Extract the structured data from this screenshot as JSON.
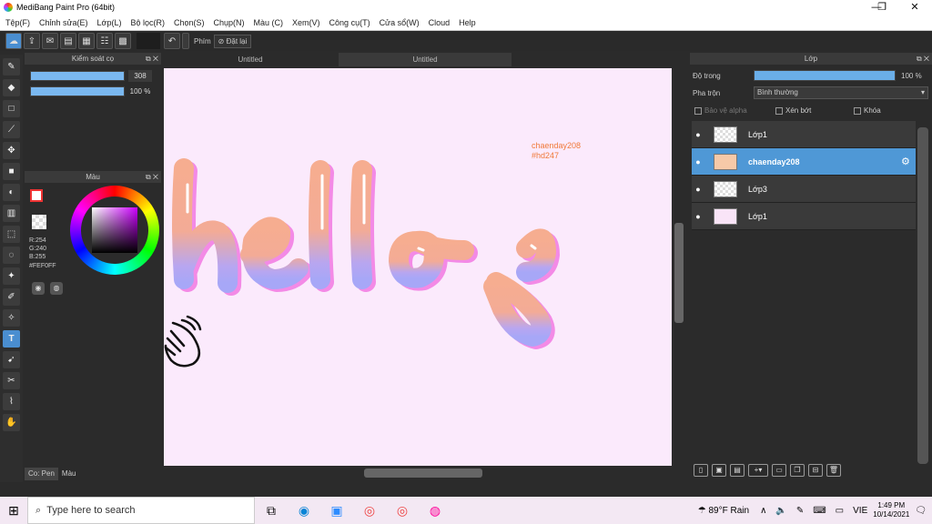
{
  "window": {
    "title": "MediBang Paint Pro (64bit)",
    "minimize": "—",
    "maximize": "❐",
    "close": "✕"
  },
  "menu": [
    "Tệp(F)",
    "Chỉnh sửa(E)",
    "Lớp(L)",
    "Bộ lọc(R)",
    "Chọn(S)",
    "Chụp(N)",
    "Màu (C)",
    "Xem(V)",
    "Công cụ(T)",
    "Cửa sổ(W)",
    "Cloud",
    "Help"
  ],
  "toolbar": {
    "undo_icon": "↶",
    "keys_label": "Phím",
    "reset_label": "Đặt lại"
  },
  "brush_panel": {
    "title": "Kiểm soát cọ",
    "size_value": "308",
    "opacity_value": "100 %",
    "size_fill": 1.0,
    "opacity_fill": 1.0
  },
  "color_panel": {
    "title": "Màu",
    "r": "R:254",
    "g": "G:240",
    "b": "B:255",
    "hex": "#FEF0FF"
  },
  "bottom_tabs": [
    "Co: Pen",
    "Màu"
  ],
  "documents": {
    "tabs": [
      "Untitled",
      "Untitled"
    ],
    "active_tab": 1
  },
  "canvas": {
    "background": "#fbeafc",
    "annotation_line1": "chaenday208",
    "annotation_line2": "#hd247"
  },
  "layers_panel": {
    "title": "Lớp",
    "opacity_label": "Độ trong",
    "opacity_value": "100 %",
    "opacity_fill": 1.0,
    "blend_label": "Pha trộn",
    "blend_value": "Bình thường",
    "protect_alpha": "Bảo vệ alpha",
    "clipping": "Xén bớt",
    "lock": "Khóa",
    "layers": [
      {
        "name": "Lớp1",
        "selected": false
      },
      {
        "name": "chaenday208",
        "selected": true
      },
      {
        "name": "Lớp3",
        "selected": false
      },
      {
        "name": "Lớp1",
        "selected": false
      }
    ]
  },
  "taskbar": {
    "search_placeholder": "Type here to search",
    "weather": "89°F  Rain",
    "lang": "VIE",
    "time": "1:49 PM",
    "date": "10/14/2021"
  },
  "colors": {
    "accent": "#4a8ed0",
    "selected_layer": "#4f98d6",
    "panel": "#2b2b2b"
  }
}
